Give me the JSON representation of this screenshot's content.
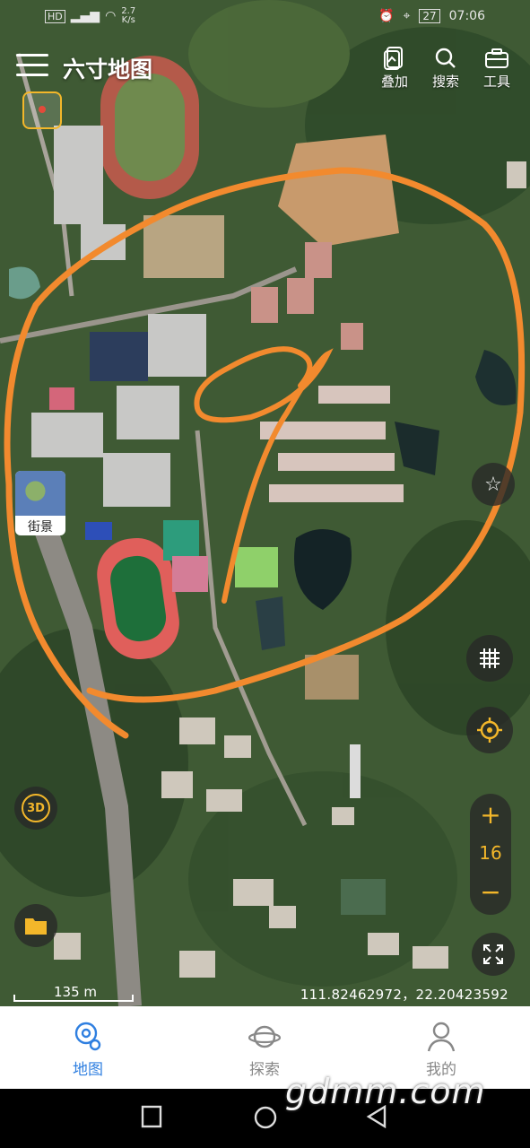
{
  "status_bar": {
    "left_icons": [
      "hd-icon",
      "signal-icon",
      "wifi-icon"
    ],
    "net_speed": "2.7",
    "net_unit": "K/s",
    "battery": "27",
    "time": "07:06"
  },
  "header": {
    "title": "六寸地图",
    "tools": [
      {
        "label": "叠加",
        "icon": "layers-icon"
      },
      {
        "label": "搜索",
        "icon": "search-icon"
      },
      {
        "label": "工具",
        "icon": "toolbox-icon"
      }
    ]
  },
  "map": {
    "street_view_label": "街景",
    "three_d_label": "3D",
    "zoom_in": "+",
    "zoom_out": "−",
    "zoom_level": "16",
    "scale_label": "135 m",
    "coordinates": "111.82462972，22.20423592",
    "accent": "#f3b72a",
    "annotation_color": "#f28a2e"
  },
  "tabs": [
    {
      "label": "地图",
      "icon": "map-pin-icon",
      "active": true
    },
    {
      "label": "探索",
      "icon": "planet-icon",
      "active": false
    },
    {
      "label": "我的",
      "icon": "user-icon",
      "active": false
    }
  ],
  "watermark": "gdmm.com",
  "colors": {
    "active_tab": "#2f7fe0",
    "inactive_tab": "#888888"
  }
}
